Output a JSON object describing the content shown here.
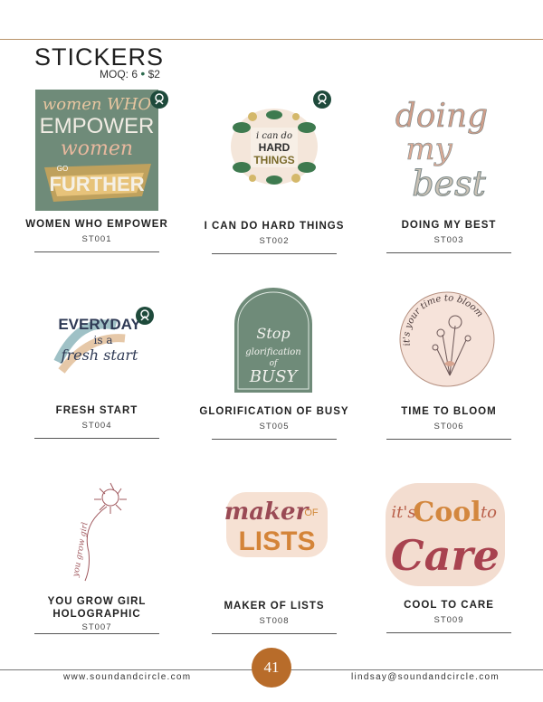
{
  "header": {
    "title": "STICKERS",
    "moq": "MOQ: 6",
    "bullet": "•",
    "price": "$2"
  },
  "products": [
    {
      "name": "WOMEN WHO EMPOWER",
      "code": "ST001",
      "art": [
        "women WHO",
        "EMPOWER",
        "women",
        "GO",
        "FURTHER"
      ]
    },
    {
      "name": "I CAN DO HARD THINGS",
      "code": "ST002",
      "art": [
        "i can do",
        "HARD",
        "THINGS"
      ]
    },
    {
      "name": "DOING MY BEST",
      "code": "ST003",
      "art": [
        "doing",
        "my",
        "best"
      ]
    },
    {
      "name": "FRESH START",
      "code": "ST004",
      "art": [
        "EVERYDAY",
        "is a",
        "fresh start"
      ]
    },
    {
      "name": "GLORIFICATION OF BUSY",
      "code": "ST005",
      "art": [
        "Stop",
        "glorification",
        "of",
        "BUSY"
      ]
    },
    {
      "name": "TIME TO BLOOM",
      "code": "ST006",
      "art": [
        "it's your time to bloom"
      ]
    },
    {
      "name": "YOU GROW GIRL",
      "name2": "HOLOGRAPHIC",
      "code": "ST007",
      "art": [
        "you grow girl"
      ]
    },
    {
      "name": "MAKER OF LISTS",
      "code": "ST008",
      "art": [
        "maker",
        "OF",
        "LISTS"
      ]
    },
    {
      "name": "COOL TO CARE",
      "code": "ST009",
      "art": [
        "it's",
        "Cool",
        "to",
        "Care"
      ]
    }
  ],
  "footer": {
    "website": "www.soundandcircle.com",
    "email": "lindsay@soundandcircle.com",
    "page": "41"
  },
  "colors": {
    "accent": "#b86c2a",
    "sage": "#6f8b79",
    "badge": "#1e4a3b"
  }
}
